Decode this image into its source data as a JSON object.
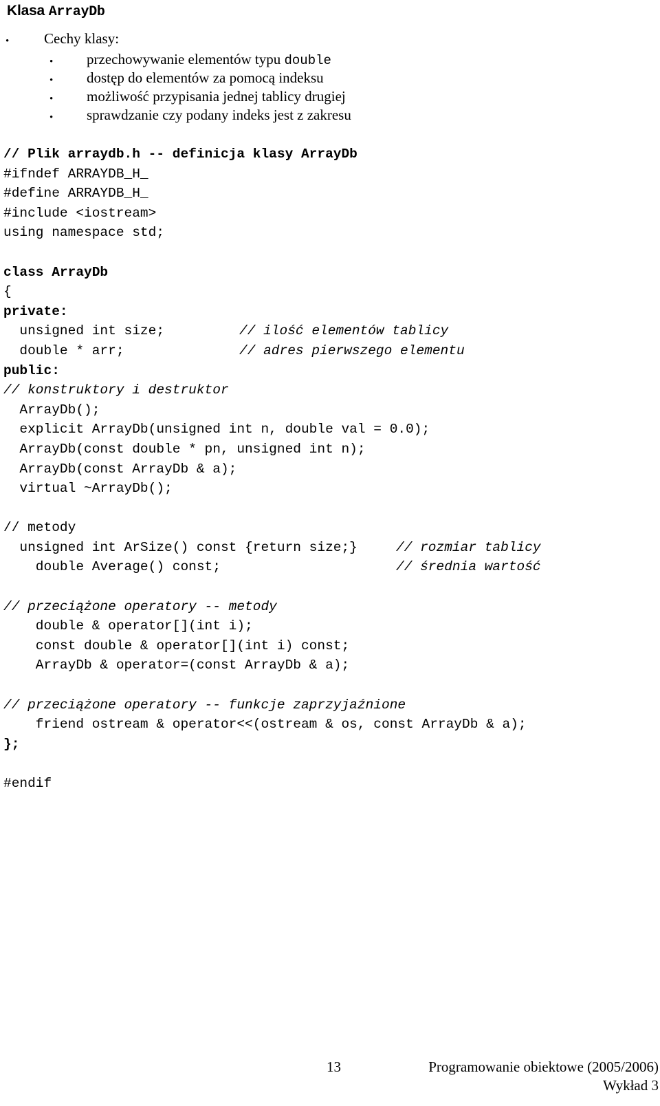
{
  "page": {
    "title_prefix": "Klasa ",
    "title_class_name": "ArrayDb"
  },
  "bullets": {
    "level1_label": "Cechy klasy:",
    "items": [
      {
        "text_before": "przechowywanie elementów typu ",
        "mono": "double",
        "text_after": ""
      },
      {
        "text_before": "dostęp do elementów za pomocą indeksu",
        "mono": "",
        "text_after": ""
      },
      {
        "text_before": "możliwość przypisania jednej tablicy drugiej",
        "mono": "",
        "text_after": ""
      },
      {
        "text_before": "sprawdzanie czy podany indeks jest z zakresu",
        "mono": "",
        "text_after": ""
      }
    ],
    "bullet_glyph": "•"
  },
  "code": {
    "language": "cpp",
    "lines": [
      {
        "main": "// Plik arraydb.h -- definicja klasy ArrayDb",
        "style": "b",
        "comment": "",
        "comment_style": ""
      },
      {
        "main": "#ifndef ARRAYDB_H_",
        "style": "",
        "comment": "",
        "comment_style": ""
      },
      {
        "main": "#define ARRAYDB_H_",
        "style": "",
        "comment": "",
        "comment_style": ""
      },
      {
        "main": "#include <iostream>",
        "style": "",
        "comment": "",
        "comment_style": ""
      },
      {
        "main": "using namespace std;",
        "style": "",
        "comment": "",
        "comment_style": ""
      },
      {
        "main": "",
        "style": "",
        "comment": "",
        "comment_style": ""
      },
      {
        "main": "class ArrayDb",
        "style": "b",
        "comment": "",
        "comment_style": ""
      },
      {
        "main": "{",
        "style": "",
        "comment": "",
        "comment_style": ""
      },
      {
        "main": "private:",
        "style": "b",
        "comment": "",
        "comment_style": ""
      },
      {
        "main": "  unsigned int size;",
        "style": "",
        "comment": "// ilość elementów tablicy",
        "comment_style": "i"
      },
      {
        "main": "  double * arr;",
        "style": "",
        "comment": "// adres pierwszego elementu",
        "comment_style": "i"
      },
      {
        "main": "public:",
        "style": "b",
        "comment": "",
        "comment_style": ""
      },
      {
        "main": "// konstruktory i destruktor",
        "style": "i",
        "comment": "",
        "comment_style": ""
      },
      {
        "main": "  ArrayDb();",
        "style": "",
        "comment": "",
        "comment_style": ""
      },
      {
        "main": "  explicit ArrayDb(unsigned int n, double val = 0.0);",
        "style": "",
        "comment": "",
        "comment_style": ""
      },
      {
        "main": "  ArrayDb(const double * pn, unsigned int n);",
        "style": "",
        "comment": "",
        "comment_style": ""
      },
      {
        "main": "  ArrayDb(const ArrayDb & a);",
        "style": "",
        "comment": "",
        "comment_style": ""
      },
      {
        "main": "  virtual ~ArrayDb();",
        "style": "",
        "comment": "",
        "comment_style": ""
      },
      {
        "main": "",
        "style": "",
        "comment": "",
        "comment_style": ""
      },
      {
        "main": "// metody",
        "style": "",
        "comment": "",
        "comment_style": ""
      },
      {
        "main": "  unsigned int ArSize() const {return size;}",
        "style": "",
        "comment": "// rozmiar tablicy",
        "comment_style": "i",
        "comment_pos": "cmt2"
      },
      {
        "main": "    double Average() const;",
        "style": "",
        "comment": "// średnia wartość",
        "comment_style": "i",
        "comment_pos": "cmt2"
      },
      {
        "main": "",
        "style": "",
        "comment": "",
        "comment_style": ""
      },
      {
        "main": "// przeciążone operatory -- metody",
        "style": "i",
        "comment": "",
        "comment_style": ""
      },
      {
        "main": "    double & operator[](int i);",
        "style": "",
        "comment": "",
        "comment_style": ""
      },
      {
        "main": "    const double & operator[](int i) const;",
        "style": "",
        "comment": "",
        "comment_style": ""
      },
      {
        "main": "    ArrayDb & operator=(const ArrayDb & a);",
        "style": "",
        "comment": "",
        "comment_style": ""
      },
      {
        "main": "",
        "style": "",
        "comment": "",
        "comment_style": ""
      },
      {
        "main": "// przeciążone operatory -- funkcje zaprzyjaźnione",
        "style": "i",
        "comment": "",
        "comment_style": ""
      },
      {
        "main": "    friend ostream & operator<<(ostream & os, const ArrayDb & a);",
        "style": "",
        "comment": "",
        "comment_style": ""
      },
      {
        "main": "};",
        "style": "b",
        "comment": "",
        "comment_style": ""
      },
      {
        "main": "",
        "style": "",
        "comment": "",
        "comment_style": ""
      },
      {
        "main": "#endif",
        "style": "",
        "comment": "",
        "comment_style": ""
      }
    ]
  },
  "footer": {
    "page_number": "13",
    "course_line": "Programowanie obiektowe (2005/2006)",
    "lecture_line": "Wykład 3"
  }
}
